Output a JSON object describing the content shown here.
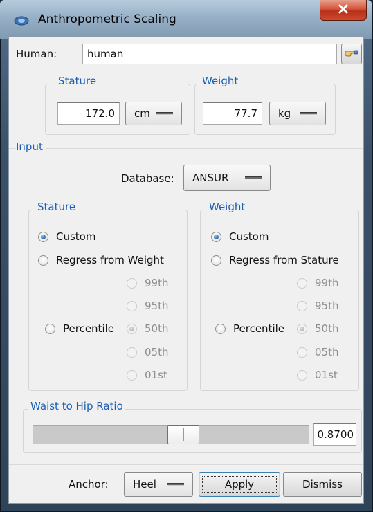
{
  "window": {
    "title": "Anthropometric Scaling"
  },
  "human": {
    "label": "Human:",
    "value": "human"
  },
  "measure": {
    "stature": {
      "title": "Stature",
      "value": "172.0",
      "unit": "cm"
    },
    "weight": {
      "title": "Weight",
      "value": "77.7",
      "unit": "kg"
    }
  },
  "input": {
    "title": "Input",
    "database": {
      "label": "Database:",
      "value": "ANSUR"
    },
    "stature_group": {
      "title": "Stature",
      "custom": "Custom",
      "regress": "Regress from Weight",
      "percentile": "Percentile",
      "options": [
        "99th",
        "95th",
        "50th",
        "05th",
        "01st"
      ],
      "selected_mode": "Custom",
      "selected_percentile": "50th"
    },
    "weight_group": {
      "title": "Weight",
      "custom": "Custom",
      "regress": "Regress from Stature",
      "percentile": "Percentile",
      "options": [
        "99th",
        "95th",
        "50th",
        "05th",
        "01st"
      ],
      "selected_mode": "Custom",
      "selected_percentile": "50th"
    }
  },
  "waist_hip": {
    "title": "Waist to Hip Ratio",
    "value": "0.8700",
    "slider_fraction": 0.55
  },
  "footer": {
    "anchor_label": "Anchor:",
    "anchor_value": "Heel",
    "apply": "Apply",
    "dismiss": "Dismiss"
  },
  "icons": {
    "window": "window-app-icon",
    "close": "close-icon",
    "pick": "pointing-hand-icon"
  }
}
